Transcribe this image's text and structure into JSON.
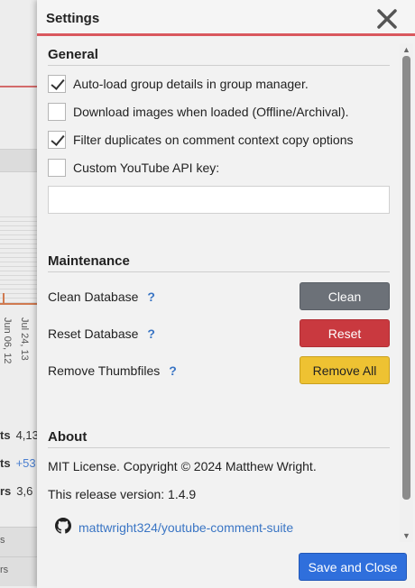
{
  "background": {
    "ticks": [
      "Jun 06, 12",
      "Jul 24, 13"
    ],
    "stats": [
      {
        "key": "ts",
        "value": "4,13"
      },
      {
        "key": "ts",
        "value": "+53"
      },
      {
        "key": "rs",
        "value": "3,6"
      }
    ],
    "rows": [
      "s",
      "rs"
    ]
  },
  "settings": {
    "title": "Settings",
    "general": {
      "heading": "General",
      "options": [
        {
          "label": "Auto-load group details in group manager.",
          "checked": true
        },
        {
          "label": "Download images when loaded (Offline/Archival).",
          "checked": false
        },
        {
          "label": "Filter duplicates on comment context copy options",
          "checked": true
        },
        {
          "label": "Custom YouTube API key:",
          "checked": false
        }
      ],
      "api_key_value": ""
    },
    "maintenance": {
      "heading": "Maintenance",
      "items": [
        {
          "label": "Clean Database",
          "help": "?",
          "button": "Clean"
        },
        {
          "label": "Reset Database",
          "help": "?",
          "button": "Reset"
        },
        {
          "label": "Remove Thumbfiles",
          "help": "?",
          "button": "Remove All"
        }
      ]
    },
    "about": {
      "heading": "About",
      "license": "MIT License. Copyright © 2024 Matthew Wright.",
      "version": "This release version: 1.4.9",
      "repo_link": "mattwright324/youtube-comment-suite"
    },
    "save_label": "Save and Close",
    "icons": {
      "close": "close-icon",
      "github": "github-icon"
    },
    "colors": {
      "accent_red": "#d9585e",
      "clean": "#6c7178",
      "reset": "#c9393f",
      "remove_all": "#eec232",
      "save": "#2f6fdc",
      "link": "#3a75c4"
    }
  }
}
